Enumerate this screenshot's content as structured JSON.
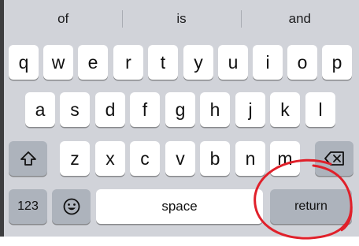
{
  "suggestions": [
    "of",
    "is",
    "and"
  ],
  "rows": {
    "row1": [
      "q",
      "w",
      "e",
      "r",
      "t",
      "y",
      "u",
      "i",
      "o",
      "p"
    ],
    "row2": [
      "a",
      "s",
      "d",
      "f",
      "g",
      "h",
      "j",
      "k",
      "l"
    ],
    "row3": [
      "z",
      "x",
      "c",
      "v",
      "b",
      "n",
      "m"
    ]
  },
  "keys": {
    "shift_icon": "shift-icon",
    "delete_icon": "delete-icon",
    "numbers_label": "123",
    "emoji_icon": "emoji-icon",
    "space_label": "space",
    "return_label": "return"
  },
  "annotation": {
    "shape": "hand-drawn circle around return key",
    "color": "#e0202a"
  },
  "colors": {
    "keyboard_bg": "#d1d3d9",
    "letter_key": "#ffffff",
    "function_key": "#adb3bc"
  }
}
